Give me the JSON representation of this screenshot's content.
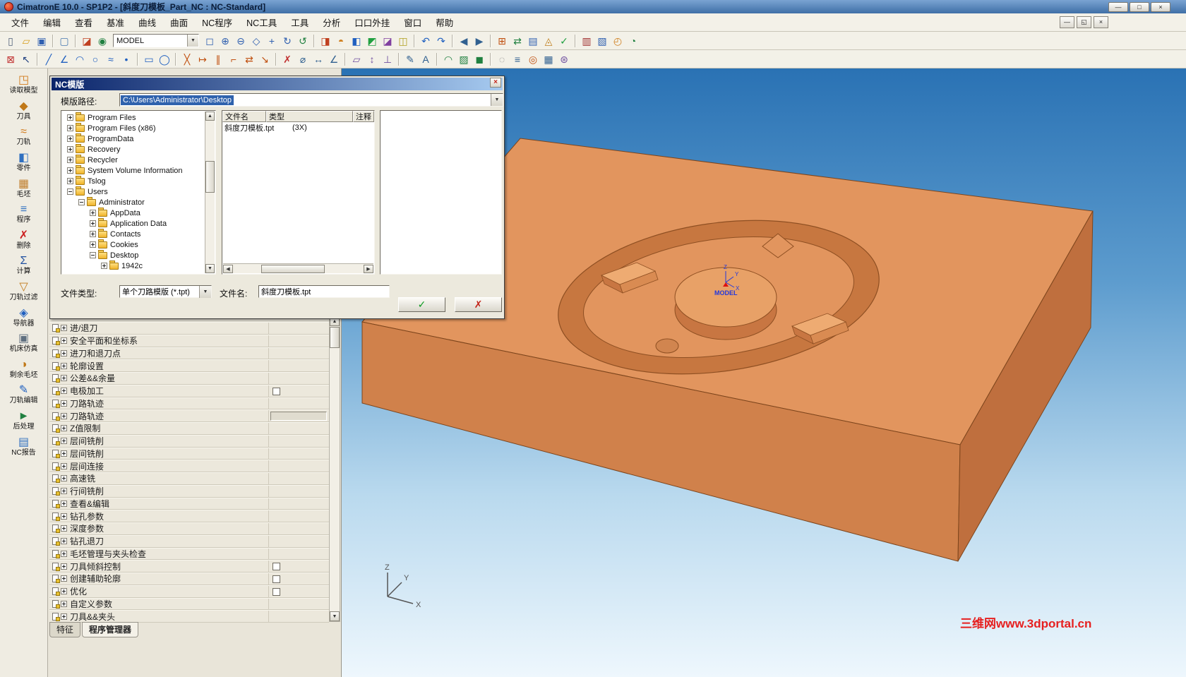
{
  "window": {
    "title": "CimatronE 10.0 - SP1P2 - [斜度刀模板_Part_NC : NC-Standard]",
    "controls": [
      {
        "name": "minimize-button",
        "g": "—"
      },
      {
        "name": "maximize-button",
        "g": "□"
      },
      {
        "name": "close-button",
        "g": "×"
      }
    ],
    "mdi_controls": [
      {
        "name": "mdi-minimize-button",
        "g": "—"
      },
      {
        "name": "mdi-restore-button",
        "g": "◱"
      },
      {
        "name": "mdi-close-button",
        "g": "×"
      }
    ]
  },
  "ui": {
    "dropdown_glyph": "▼",
    "up_glyph": "▲",
    "down_glyph": "▼",
    "left_glyph": "◀",
    "right_glyph": "▶"
  },
  "colors": {
    "selection_blue": "#2f62ad",
    "dialog_title_start": "#0a246a",
    "dialog_title_end": "#a6caf0",
    "viewport_top": "#2a72b4",
    "viewport_bottom": "#eef7fd",
    "model_orange_top": "#e2955e",
    "model_orange_front": "#d0814b",
    "model_orange_side": "#bf6f3e",
    "watermark_red": "#e62020"
  },
  "menu": {
    "items": [
      {
        "name": "menu-file",
        "label": "文件"
      },
      {
        "name": "menu-edit",
        "label": "编辑"
      },
      {
        "name": "menu-view",
        "label": "查看"
      },
      {
        "name": "menu-datum",
        "label": "基准"
      },
      {
        "name": "menu-curve",
        "label": "曲线"
      },
      {
        "name": "menu-surface",
        "label": "曲面"
      },
      {
        "name": "menu-nc-program",
        "label": "NC程序"
      },
      {
        "name": "menu-nc-tools",
        "label": "NC工具"
      },
      {
        "name": "menu-tools",
        "label": "工具"
      },
      {
        "name": "menu-analysis",
        "label": "分析"
      },
      {
        "name": "menu-plugin",
        "label": "口口外挂"
      },
      {
        "name": "menu-window",
        "label": "窗口"
      },
      {
        "name": "menu-help",
        "label": "帮助"
      }
    ]
  },
  "toolbar_main": {
    "icons_left": [
      {
        "name": "new-file-icon",
        "g": "▯",
        "c": "#50607a"
      },
      {
        "name": "open-folder-icon",
        "g": "▱",
        "c": "#d8a020"
      },
      {
        "name": "save-icon",
        "g": "▣",
        "c": "#3060b0"
      },
      {
        "sep": true
      },
      {
        "name": "screen-display-icon",
        "g": "▢",
        "c": "#4878b0"
      },
      {
        "sep": true
      },
      {
        "name": "display-cube-icon",
        "g": "◪",
        "c": "#c04020"
      },
      {
        "name": "visibility-eye-icon",
        "g": "◉",
        "c": "#208040"
      }
    ],
    "model_combo": {
      "value": "MODEL"
    },
    "icons_right": [
      {
        "name": "zoom-window-icon",
        "g": "◻",
        "c": "#3060b0"
      },
      {
        "name": "zoom-in-icon",
        "g": "⊕",
        "c": "#3060b0"
      },
      {
        "name": "zoom-out-icon",
        "g": "⊖",
        "c": "#3060b0"
      },
      {
        "name": "zoom-fit-icon",
        "g": "◇",
        "c": "#3060b0"
      },
      {
        "name": "pan-icon",
        "g": "+",
        "c": "#3060b0"
      },
      {
        "name": "rotate-view-icon",
        "g": "↻",
        "c": "#3060b0"
      },
      {
        "name": "refresh-icon",
        "g": "↺",
        "c": "#208040"
      },
      {
        "sep": true
      },
      {
        "name": "view-front-icon",
        "g": "◨",
        "c": "#c04020"
      },
      {
        "name": "view-top-icon",
        "g": "◓",
        "c": "#d08020"
      },
      {
        "name": "view-side-icon",
        "g": "◧",
        "c": "#2060c0"
      },
      {
        "name": "view-iso-icon",
        "g": "◩",
        "c": "#20a040"
      },
      {
        "name": "view-back-icon",
        "g": "◪",
        "c": "#8040a0"
      },
      {
        "name": "view-bottom-icon",
        "g": "◫",
        "c": "#b0a020"
      },
      {
        "sep": true
      },
      {
        "name": "undo-icon",
        "g": "↶",
        "c": "#2060c0"
      },
      {
        "name": "redo-icon",
        "g": "↷",
        "c": "#2060c0"
      },
      {
        "sep": true
      },
      {
        "name": "prev-step-icon",
        "g": "◀",
        "c": "#306090"
      },
      {
        "name": "next-step-icon",
        "g": "▶",
        "c": "#306090"
      },
      {
        "sep": true
      },
      {
        "name": "create-procedure-icon",
        "g": "⊞",
        "c": "#c05010"
      },
      {
        "name": "data-exchange-icon",
        "g": "⇄",
        "c": "#208040"
      },
      {
        "name": "report-icon",
        "g": "▤",
        "c": "#3060b0"
      },
      {
        "name": "template-icon",
        "g": "◬",
        "c": "#c08020"
      },
      {
        "name": "verify-icon",
        "g": "✓",
        "c": "#20a040"
      },
      {
        "sep": true
      },
      {
        "name": "simulate-icon",
        "g": "▥",
        "c": "#a03030"
      },
      {
        "name": "machine-icon",
        "g": "▧",
        "c": "#3060b0"
      },
      {
        "name": "time-estimate-icon",
        "g": "◴",
        "c": "#d08020"
      },
      {
        "name": "stock-icon",
        "g": "◔",
        "c": "#208040"
      }
    ]
  },
  "toolbar_second": {
    "icons": [
      {
        "name": "exit-env-icon",
        "g": "⊠",
        "c": "#c03030"
      },
      {
        "name": "select-arrow-icon",
        "g": "↖",
        "c": "#204080"
      },
      {
        "sep": true
      },
      {
        "name": "line-icon",
        "g": "╱",
        "c": "#2060c0"
      },
      {
        "name": "polyline-icon",
        "g": "∠",
        "c": "#2060c0"
      },
      {
        "name": "arc-icon",
        "g": "◠",
        "c": "#2060c0"
      },
      {
        "name": "circle-icon",
        "g": "○",
        "c": "#2060c0"
      },
      {
        "name": "spline-icon",
        "g": "≈",
        "c": "#2060c0"
      },
      {
        "name": "point-icon",
        "g": "•",
        "c": "#2060c0"
      },
      {
        "sep": true
      },
      {
        "name": "rectangle-icon",
        "g": "▭",
        "c": "#2060c0"
      },
      {
        "name": "ellipse-icon",
        "g": "◯",
        "c": "#2060c0"
      },
      {
        "sep": true
      },
      {
        "name": "trim-icon",
        "g": "╳",
        "c": "#c05010"
      },
      {
        "name": "extend-icon",
        "g": "↦",
        "c": "#c05010"
      },
      {
        "name": "offset-icon",
        "g": "∥",
        "c": "#c05010"
      },
      {
        "name": "fillet-icon",
        "g": "⌐",
        "c": "#c05010"
      },
      {
        "name": "mirror-icon",
        "g": "⇄",
        "c": "#c05010"
      },
      {
        "name": "scale-icon",
        "g": "↘",
        "c": "#c05010"
      },
      {
        "sep": true
      },
      {
        "name": "delete-icon",
        "g": "✗",
        "c": "#c03030"
      },
      {
        "name": "measure-icon",
        "g": "⌀",
        "c": "#306090"
      },
      {
        "name": "dimension-icon",
        "g": "↔",
        "c": "#306090"
      },
      {
        "name": "angle-icon",
        "g": "∠",
        "c": "#306090"
      },
      {
        "sep": true
      },
      {
        "name": "plane-icon",
        "g": "▱",
        "c": "#7050a0"
      },
      {
        "name": "axis-icon",
        "g": "↕",
        "c": "#7050a0"
      },
      {
        "name": "csys-icon",
        "g": "⊥",
        "c": "#7050a0"
      },
      {
        "sep": true
      },
      {
        "name": "sketch-icon",
        "g": "✎",
        "c": "#306090"
      },
      {
        "name": "text-icon",
        "g": "A",
        "c": "#306090"
      },
      {
        "sep": true
      },
      {
        "name": "projection-icon",
        "g": "◠",
        "c": "#208040"
      },
      {
        "name": "surface-icon",
        "g": "▨",
        "c": "#208040"
      },
      {
        "name": "solid-icon",
        "g": "◼",
        "c": "#208040"
      },
      {
        "sep": true
      },
      {
        "name": "hide-icon",
        "g": "◌",
        "c": "#808080"
      },
      {
        "name": "layers-icon",
        "g": "≡",
        "c": "#306090"
      },
      {
        "name": "snap-icon",
        "g": "◎",
        "c": "#c05010"
      },
      {
        "name": "grid-icon",
        "g": "▦",
        "c": "#306090"
      },
      {
        "name": "options-icon",
        "g": "⊛",
        "c": "#7050a0"
      }
    ]
  },
  "sidebar": {
    "items": [
      {
        "name": "sidebar-item-read-model",
        "glyph": "◳",
        "c": "#d07818",
        "label": "读取模型"
      },
      {
        "name": "sidebar-item-tools",
        "glyph": "◆",
        "c": "#c07818",
        "label": "刀具"
      },
      {
        "name": "sidebar-item-toolpath",
        "glyph": "≈",
        "c": "#d07818",
        "label": "刀轨"
      },
      {
        "name": "sidebar-item-part",
        "glyph": "◧",
        "c": "#3070c0",
        "label": "零件"
      },
      {
        "name": "sidebar-item-stock",
        "glyph": "▦",
        "c": "#c08030",
        "label": "毛坯"
      },
      {
        "name": "sidebar-item-program",
        "glyph": "≡",
        "c": "#3070c0",
        "label": "程序"
      },
      {
        "name": "sidebar-item-delete",
        "glyph": "✗",
        "c": "#cc2020",
        "label": "删除"
      },
      {
        "name": "sidebar-item-calculate",
        "glyph": "Σ",
        "c": "#2050a0",
        "label": "计算"
      },
      {
        "name": "sidebar-item-toolpath-filter",
        "glyph": "▽",
        "c": "#c07818",
        "label": "刀轨过滤"
      },
      {
        "name": "sidebar-item-navigator",
        "glyph": "◈",
        "c": "#2060c0",
        "label": "导航器"
      },
      {
        "name": "sidebar-item-machine-simulation",
        "glyph": "▣",
        "c": "#607080",
        "label": "机床仿真"
      },
      {
        "name": "sidebar-item-remaining-stock",
        "glyph": "◑",
        "c": "#c07818",
        "label": "剩余毛坯"
      },
      {
        "name": "sidebar-item-toolpath-edit",
        "glyph": "✎",
        "c": "#2060c0",
        "label": "刀轨编辑"
      },
      {
        "name": "sidebar-item-post-process",
        "glyph": "►",
        "c": "#208040",
        "label": "后处理"
      },
      {
        "name": "sidebar-item-nc-report",
        "glyph": "▤",
        "c": "#3070c0",
        "label": "NC报告"
      }
    ]
  },
  "dialog": {
    "title": "NC模版",
    "close_glyph": "×",
    "path_label": "模版路径:",
    "path_value": "C:\\Users\\Administrator\\Desktop",
    "tree": [
      {
        "label": "Program Files",
        "level": 0,
        "state": "plus"
      },
      {
        "label": "Program Files (x86)",
        "level": 0,
        "state": "plus"
      },
      {
        "label": "ProgramData",
        "level": 0,
        "state": "plus"
      },
      {
        "label": "Recovery",
        "level": 0,
        "state": "plus"
      },
      {
        "label": "Recycler",
        "level": 0,
        "state": "plus"
      },
      {
        "label": "System Volume Information",
        "level": 0,
        "state": "plus"
      },
      {
        "label": "Tslog",
        "level": 0,
        "state": "plus"
      },
      {
        "label": "Users",
        "level": 0,
        "state": "minus"
      },
      {
        "label": "Administrator",
        "level": 1,
        "state": "minus"
      },
      {
        "label": "AppData",
        "level": 2,
        "state": "plus"
      },
      {
        "label": "Application Data",
        "level": 2,
        "state": "plus"
      },
      {
        "label": "Contacts",
        "level": 2,
        "state": "plus"
      },
      {
        "label": "Cookies",
        "level": 2,
        "state": "plus"
      },
      {
        "label": "Desktop",
        "level": 2,
        "state": "minus"
      },
      {
        "label": "1942c",
        "level": 3,
        "state": "plus"
      }
    ],
    "list": {
      "columns": [
        "文件名",
        "类型",
        "注释"
      ],
      "rows": [
        {
          "file": "斜度刀模板.tpt",
          "type": "(3X)"
        }
      ]
    },
    "file_type_label": "文件类型:",
    "file_type_value": "单个刀路模版 (*.tpt)",
    "file_name_label": "文件名:",
    "file_name_value": "斜度刀模板.tpt",
    "ok_glyph": "✓",
    "cancel_glyph": "✗"
  },
  "param_panel": {
    "rows": [
      {
        "label": "进/退刀",
        "control": "none"
      },
      {
        "label": "安全平面和坐标系",
        "control": "none"
      },
      {
        "label": "进刀和退刀点",
        "control": "none"
      },
      {
        "label": "轮廓设置",
        "control": "none"
      },
      {
        "label": "公差&&余量",
        "control": "none"
      },
      {
        "label": "电极加工",
        "control": "checkbox"
      },
      {
        "label": "刀路轨迹",
        "control": "none"
      },
      {
        "label": "刀路轨迹",
        "control": "input"
      },
      {
        "label": "Z值限制",
        "control": "none"
      },
      {
        "label": "层间铣削",
        "control": "none"
      },
      {
        "label": "层间铣削",
        "control": "none"
      },
      {
        "label": "层间连接",
        "control": "none"
      },
      {
        "label": "高速铣",
        "control": "none"
      },
      {
        "label": "行间铣削",
        "control": "none"
      },
      {
        "label": "查看&编辑",
        "control": "none"
      },
      {
        "label": "钻孔参数",
        "control": "none"
      },
      {
        "label": "深度参数",
        "control": "none"
      },
      {
        "label": "钻孔退刀",
        "control": "none"
      },
      {
        "label": "毛坯管理与夹头检查",
        "control": "none"
      },
      {
        "label": "刀具倾斜控制",
        "control": "checkbox"
      },
      {
        "label": "创建辅助轮廓",
        "control": "checkbox"
      },
      {
        "label": "优化",
        "control": "checkbox"
      },
      {
        "label": "自定义参数",
        "control": "none"
      },
      {
        "label": "刀具&&夹头",
        "control": "none"
      }
    ],
    "tabs": [
      {
        "name": "tab-features",
        "label": "特征",
        "active": false
      },
      {
        "name": "tab-program-manager",
        "label": "程序管理器",
        "active": true
      }
    ]
  },
  "viewport": {
    "watermark": "三维网www.3dportal.cn",
    "model_marker": {
      "label": "MODEL",
      "x": "X",
      "y": "Y",
      "z": "Z"
    },
    "triad": {
      "x": "X",
      "y": "Y",
      "z": "Z"
    }
  }
}
